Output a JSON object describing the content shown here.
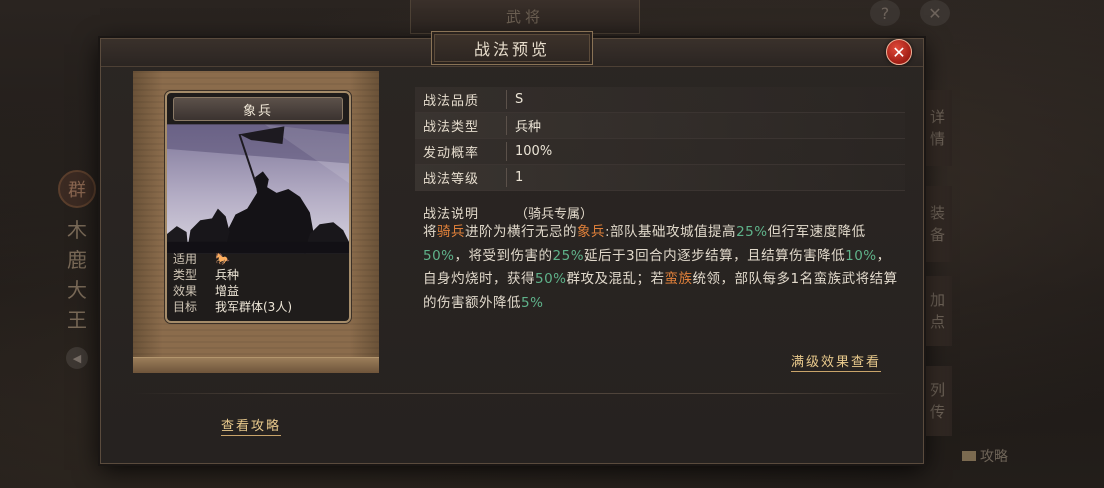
{
  "background": {
    "page_title": "武将",
    "help_icon": "?",
    "close_icon": "✕",
    "faction": "群",
    "general_name": [
      "木",
      "鹿",
      "大",
      "王"
    ],
    "side_tabs": [
      {
        "label": [
          "详",
          "情"
        ]
      },
      {
        "label": [
          "装",
          "备"
        ]
      },
      {
        "label": [
          "加",
          "点"
        ]
      },
      {
        "label": [
          "列",
          "传"
        ]
      }
    ],
    "guide_label": "攻略"
  },
  "modal": {
    "title": "战法预览",
    "close_label": "✕",
    "card": {
      "name": "象兵",
      "info": [
        {
          "key": "适用",
          "value": "🐎"
        },
        {
          "key": "类型",
          "value": "兵种"
        },
        {
          "key": "效果",
          "value": "增益"
        },
        {
          "key": "目标",
          "value": "我军群体(3人)"
        }
      ]
    },
    "attributes": [
      {
        "key": "战法品质",
        "value": "S"
      },
      {
        "key": "战法类型",
        "value": "兵种"
      },
      {
        "key": "发动概率",
        "value": "100%"
      },
      {
        "key": "战法等级",
        "value": "1"
      }
    ],
    "description": {
      "label": "战法说明",
      "tag": "（骑兵专属）",
      "segments": [
        {
          "text": "将",
          "style": "plain"
        },
        {
          "text": "骑兵",
          "style": "orange"
        },
        {
          "text": "进阶为横行无忌的",
          "style": "plain"
        },
        {
          "text": "象兵",
          "style": "orange"
        },
        {
          "text": ":部队基础攻城值提高",
          "style": "plain"
        },
        {
          "text": "25%",
          "style": "green"
        },
        {
          "text": "但行军速度降低",
          "style": "plain"
        },
        {
          "text": "50%",
          "style": "green"
        },
        {
          "text": "，将受到伤害的",
          "style": "plain"
        },
        {
          "text": "25%",
          "style": "green"
        },
        {
          "text": "延后于3回合内逐步结算，且结算伤害降低",
          "style": "plain"
        },
        {
          "text": "10%",
          "style": "green"
        },
        {
          "text": "，自身灼烧时，获得",
          "style": "plain"
        },
        {
          "text": "50%",
          "style": "green"
        },
        {
          "text": "群攻及混乱；若",
          "style": "plain"
        },
        {
          "text": "蛮族",
          "style": "orange"
        },
        {
          "text": "统领，部队每多1名蛮族武将结算的伤害额外降低",
          "style": "plain"
        },
        {
          "text": "5%",
          "style": "green"
        }
      ]
    },
    "max_level_link": "满级效果查看",
    "guide_link": "查看攻略"
  },
  "colors": {
    "highlight_orange": "#e0803a",
    "highlight_green": "#5fb28a",
    "link": "#e8c98c",
    "close_button": "#c5281c"
  }
}
